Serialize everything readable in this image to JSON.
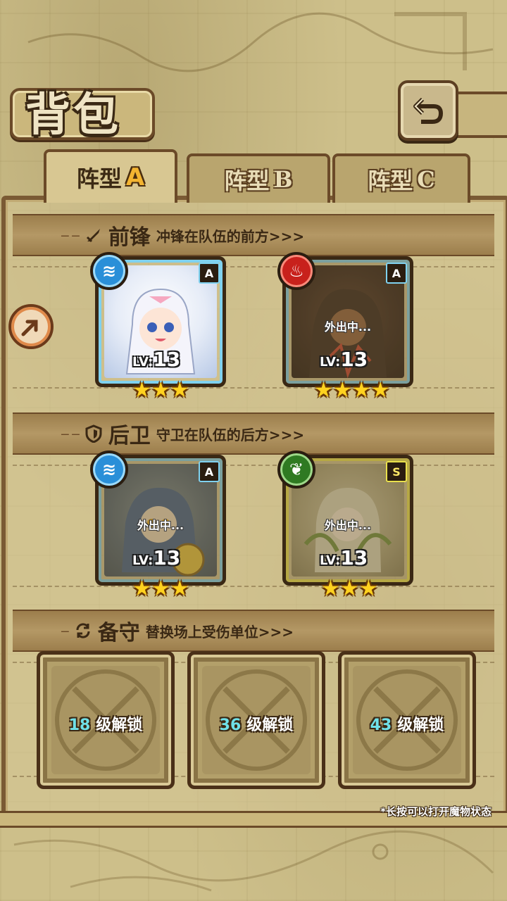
{
  "title": "背包",
  "tabs": [
    {
      "label": "阵型",
      "letter": "A",
      "active": true
    },
    {
      "label": "阵型",
      "letter": "B",
      "active": false
    },
    {
      "label": "阵型",
      "letter": "C",
      "active": false
    }
  ],
  "sections": {
    "front": {
      "name": "前锋",
      "desc": "冲锋在队伍的前方>>>",
      "icon": "sword-icon"
    },
    "back": {
      "name": "后卫",
      "desc": "守卫在队伍的后方>>>",
      "icon": "shield-icon"
    },
    "reserve": {
      "name": "备守",
      "desc": "替换场上受伤单位>>>",
      "icon": "swap-icon"
    }
  },
  "cards": [
    {
      "element": "water",
      "rank": "A",
      "level_prefix": "LV:",
      "level": "13",
      "stars": 3,
      "status": ""
    },
    {
      "element": "fire",
      "rank": "A",
      "level_prefix": "LV:",
      "level": "13",
      "stars": 4,
      "status": "外出中..."
    },
    {
      "element": "water",
      "rank": "A",
      "level_prefix": "LV:",
      "level": "13",
      "stars": 3,
      "status": "外出中..."
    },
    {
      "element": "wood",
      "rank": "S",
      "level_prefix": "LV:",
      "level": "13",
      "stars": 3,
      "status": "外出中..."
    }
  ],
  "reserve_slots": [
    {
      "level": "18",
      "label": "级解锁"
    },
    {
      "level": "36",
      "label": "级解锁"
    },
    {
      "level": "43",
      "label": "级解锁"
    }
  ],
  "hint": "*长按可以打开魔物状态",
  "colors": {
    "frame": "#6b4a28",
    "water": "#2a8fd8",
    "fire": "#c8211c",
    "wood": "#2f7a22",
    "star": "#ffd21f"
  }
}
